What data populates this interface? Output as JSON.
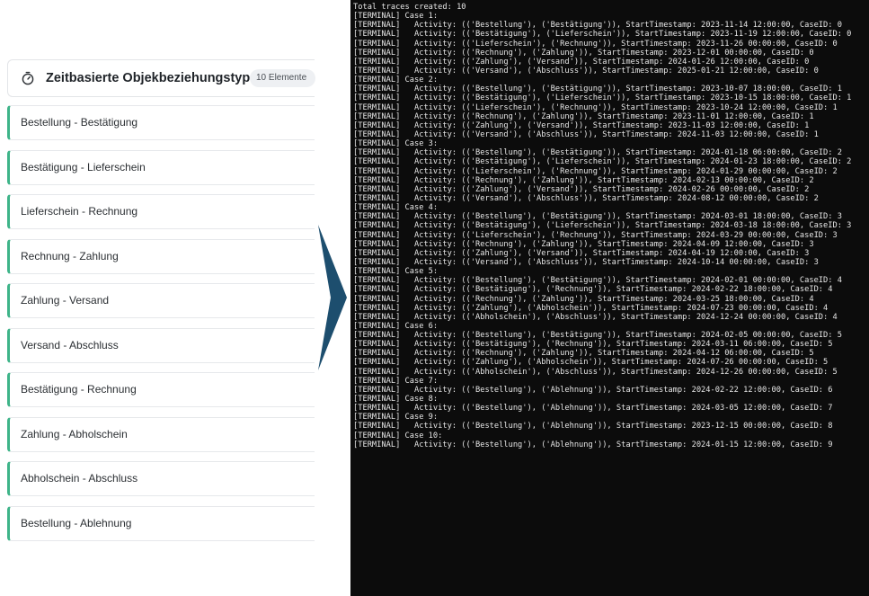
{
  "panel": {
    "title": "Zeitbasierte Objekbeziehungstypen",
    "badge": "10 Elemente",
    "icon": "timer-icon",
    "accent_color": "#3eb489",
    "items": [
      {
        "label": "Bestellung - Bestätigung"
      },
      {
        "label": "Bestätigung - Lieferschein"
      },
      {
        "label": "Lieferschein - Rechnung"
      },
      {
        "label": "Rechnung - Zahlung"
      },
      {
        "label": "Zahlung - Versand"
      },
      {
        "label": "Versand - Abschluss"
      },
      {
        "label": "Bestätigung - Rechnung"
      },
      {
        "label": "Zahlung - Abholschein"
      },
      {
        "label": "Abholschein - Abschluss"
      },
      {
        "label": "Bestellung - Ablehnung"
      }
    ]
  },
  "arrow": {
    "icon": "chevron-right-icon",
    "color": "#1d4e6e"
  },
  "terminal": {
    "lines": [
      "Total traces created: 10",
      "[TERMINAL] Case 1:",
      "[TERMINAL]   Activity: (('Bestellung'), ('Bestätigung')), StartTimestamp: 2023-11-14 12:00:00, CaseID: 0",
      "[TERMINAL]   Activity: (('Bestätigung'), ('Lieferschein')), StartTimestamp: 2023-11-19 12:00:00, CaseID: 0",
      "[TERMINAL]   Activity: (('Lieferschein'), ('Rechnung')), StartTimestamp: 2023-11-26 00:00:00, CaseID: 0",
      "[TERMINAL]   Activity: (('Rechnung'), ('Zahlung')), StartTimestamp: 2023-12-01 00:00:00, CaseID: 0",
      "[TERMINAL]   Activity: (('Zahlung'), ('Versand')), StartTimestamp: 2024-01-26 12:00:00, CaseID: 0",
      "[TERMINAL]   Activity: (('Versand'), ('Abschluss')), StartTimestamp: 2025-01-21 12:00:00, CaseID: 0",
      "[TERMINAL] Case 2:",
      "[TERMINAL]   Activity: (('Bestellung'), ('Bestätigung')), StartTimestamp: 2023-10-07 18:00:00, CaseID: 1",
      "[TERMINAL]   Activity: (('Bestätigung'), ('Lieferschein')), StartTimestamp: 2023-10-15 18:00:00, CaseID: 1",
      "[TERMINAL]   Activity: (('Lieferschein'), ('Rechnung')), StartTimestamp: 2023-10-24 12:00:00, CaseID: 1",
      "[TERMINAL]   Activity: (('Rechnung'), ('Zahlung')), StartTimestamp: 2023-11-01 12:00:00, CaseID: 1",
      "[TERMINAL]   Activity: (('Zahlung'), ('Versand')), StartTimestamp: 2023-11-03 12:00:00, CaseID: 1",
      "[TERMINAL]   Activity: (('Versand'), ('Abschluss')), StartTimestamp: 2024-11-03 12:00:00, CaseID: 1",
      "[TERMINAL] Case 3:",
      "[TERMINAL]   Activity: (('Bestellung'), ('Bestätigung')), StartTimestamp: 2024-01-18 06:00:00, CaseID: 2",
      "[TERMINAL]   Activity: (('Bestätigung'), ('Lieferschein')), StartTimestamp: 2024-01-23 18:00:00, CaseID: 2",
      "[TERMINAL]   Activity: (('Lieferschein'), ('Rechnung')), StartTimestamp: 2024-01-29 00:00:00, CaseID: 2",
      "[TERMINAL]   Activity: (('Rechnung'), ('Zahlung')), StartTimestamp: 2024-02-13 00:00:00, CaseID: 2",
      "[TERMINAL]   Activity: (('Zahlung'), ('Versand')), StartTimestamp: 2024-02-26 00:00:00, CaseID: 2",
      "[TERMINAL]   Activity: (('Versand'), ('Abschluss')), StartTimestamp: 2024-08-12 00:00:00, CaseID: 2",
      "[TERMINAL] Case 4:",
      "[TERMINAL]   Activity: (('Bestellung'), ('Bestätigung')), StartTimestamp: 2024-03-01 18:00:00, CaseID: 3",
      "[TERMINAL]   Activity: (('Bestätigung'), ('Lieferschein')), StartTimestamp: 2024-03-18 18:00:00, CaseID: 3",
      "[TERMINAL]   Activity: (('Lieferschein'), ('Rechnung')), StartTimestamp: 2024-03-29 00:00:00, CaseID: 3",
      "[TERMINAL]   Activity: (('Rechnung'), ('Zahlung')), StartTimestamp: 2024-04-09 12:00:00, CaseID: 3",
      "[TERMINAL]   Activity: (('Zahlung'), ('Versand')), StartTimestamp: 2024-04-19 12:00:00, CaseID: 3",
      "[TERMINAL]   Activity: (('Versand'), ('Abschluss')), StartTimestamp: 2024-10-14 00:00:00, CaseID: 3",
      "[TERMINAL] Case 5:",
      "[TERMINAL]   Activity: (('Bestellung'), ('Bestätigung')), StartTimestamp: 2024-02-01 00:00:00, CaseID: 4",
      "[TERMINAL]   Activity: (('Bestätigung'), ('Rechnung')), StartTimestamp: 2024-02-22 18:00:00, CaseID: 4",
      "[TERMINAL]   Activity: (('Rechnung'), ('Zahlung')), StartTimestamp: 2024-03-25 18:00:00, CaseID: 4",
      "[TERMINAL]   Activity: (('Zahlung'), ('Abholschein')), StartTimestamp: 2024-07-23 00:00:00, CaseID: 4",
      "[TERMINAL]   Activity: (('Abholschein'), ('Abschluss')), StartTimestamp: 2024-12-24 00:00:00, CaseID: 4",
      "[TERMINAL] Case 6:",
      "[TERMINAL]   Activity: (('Bestellung'), ('Bestätigung')), StartTimestamp: 2024-02-05 00:00:00, CaseID: 5",
      "[TERMINAL]   Activity: (('Bestätigung'), ('Rechnung')), StartTimestamp: 2024-03-11 06:00:00, CaseID: 5",
      "[TERMINAL]   Activity: (('Rechnung'), ('Zahlung')), StartTimestamp: 2024-04-12 06:00:00, CaseID: 5",
      "[TERMINAL]   Activity: (('Zahlung'), ('Abholschein')), StartTimestamp: 2024-07-26 00:00:00, CaseID: 5",
      "[TERMINAL]   Activity: (('Abholschein'), ('Abschluss')), StartTimestamp: 2024-12-26 00:00:00, CaseID: 5",
      "[TERMINAL] Case 7:",
      "[TERMINAL]   Activity: (('Bestellung'), ('Ablehnung')), StartTimestamp: 2024-02-22 12:00:00, CaseID: 6",
      "[TERMINAL] Case 8:",
      "[TERMINAL]   Activity: (('Bestellung'), ('Ablehnung')), StartTimestamp: 2024-03-05 12:00:00, CaseID: 7",
      "[TERMINAL] Case 9:",
      "[TERMINAL]   Activity: (('Bestellung'), ('Ablehnung')), StartTimestamp: 2023-12-15 00:00:00, CaseID: 8",
      "[TERMINAL] Case 10:",
      "[TERMINAL]   Activity: (('Bestellung'), ('Ablehnung')), StartTimestamp: 2024-01-15 12:00:00, CaseID: 9"
    ]
  }
}
